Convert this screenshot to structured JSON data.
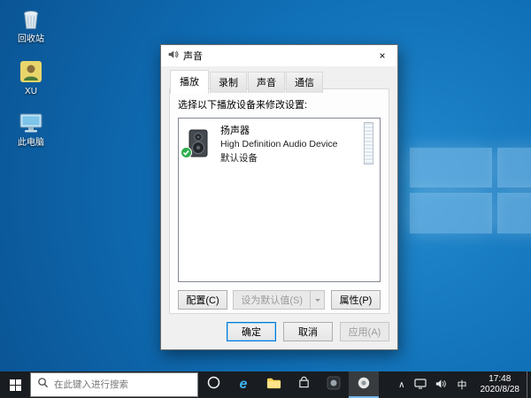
{
  "desktop": {
    "icons": [
      {
        "label": "回收站"
      },
      {
        "label": "XU"
      },
      {
        "label": "此电脑"
      }
    ]
  },
  "dialog": {
    "title": "声音",
    "close_glyph": "×",
    "tabs": [
      {
        "label": "播放"
      },
      {
        "label": "录制"
      },
      {
        "label": "声音"
      },
      {
        "label": "通信"
      }
    ],
    "instruction": "选择以下播放设备来修改设置:",
    "device": {
      "name": "扬声器",
      "description": "High Definition Audio Device",
      "status": "默认设备"
    },
    "actions": {
      "configure": "配置(C)",
      "set_default": "设为默认值(S)",
      "properties": "属性(P)"
    },
    "footer": {
      "ok": "确定",
      "cancel": "取消",
      "apply": "应用(A)"
    }
  },
  "taskbar": {
    "search_placeholder": "在此键入进行搜索",
    "edge_glyph": "e",
    "tray": {
      "expand_glyph": "∧",
      "input_method": "中",
      "time": "17:48",
      "date": "2020/8/28"
    }
  },
  "colors": {
    "accent": "#0078d7",
    "desktop_blue": "#1070b8",
    "taskbar": "#191c20"
  }
}
